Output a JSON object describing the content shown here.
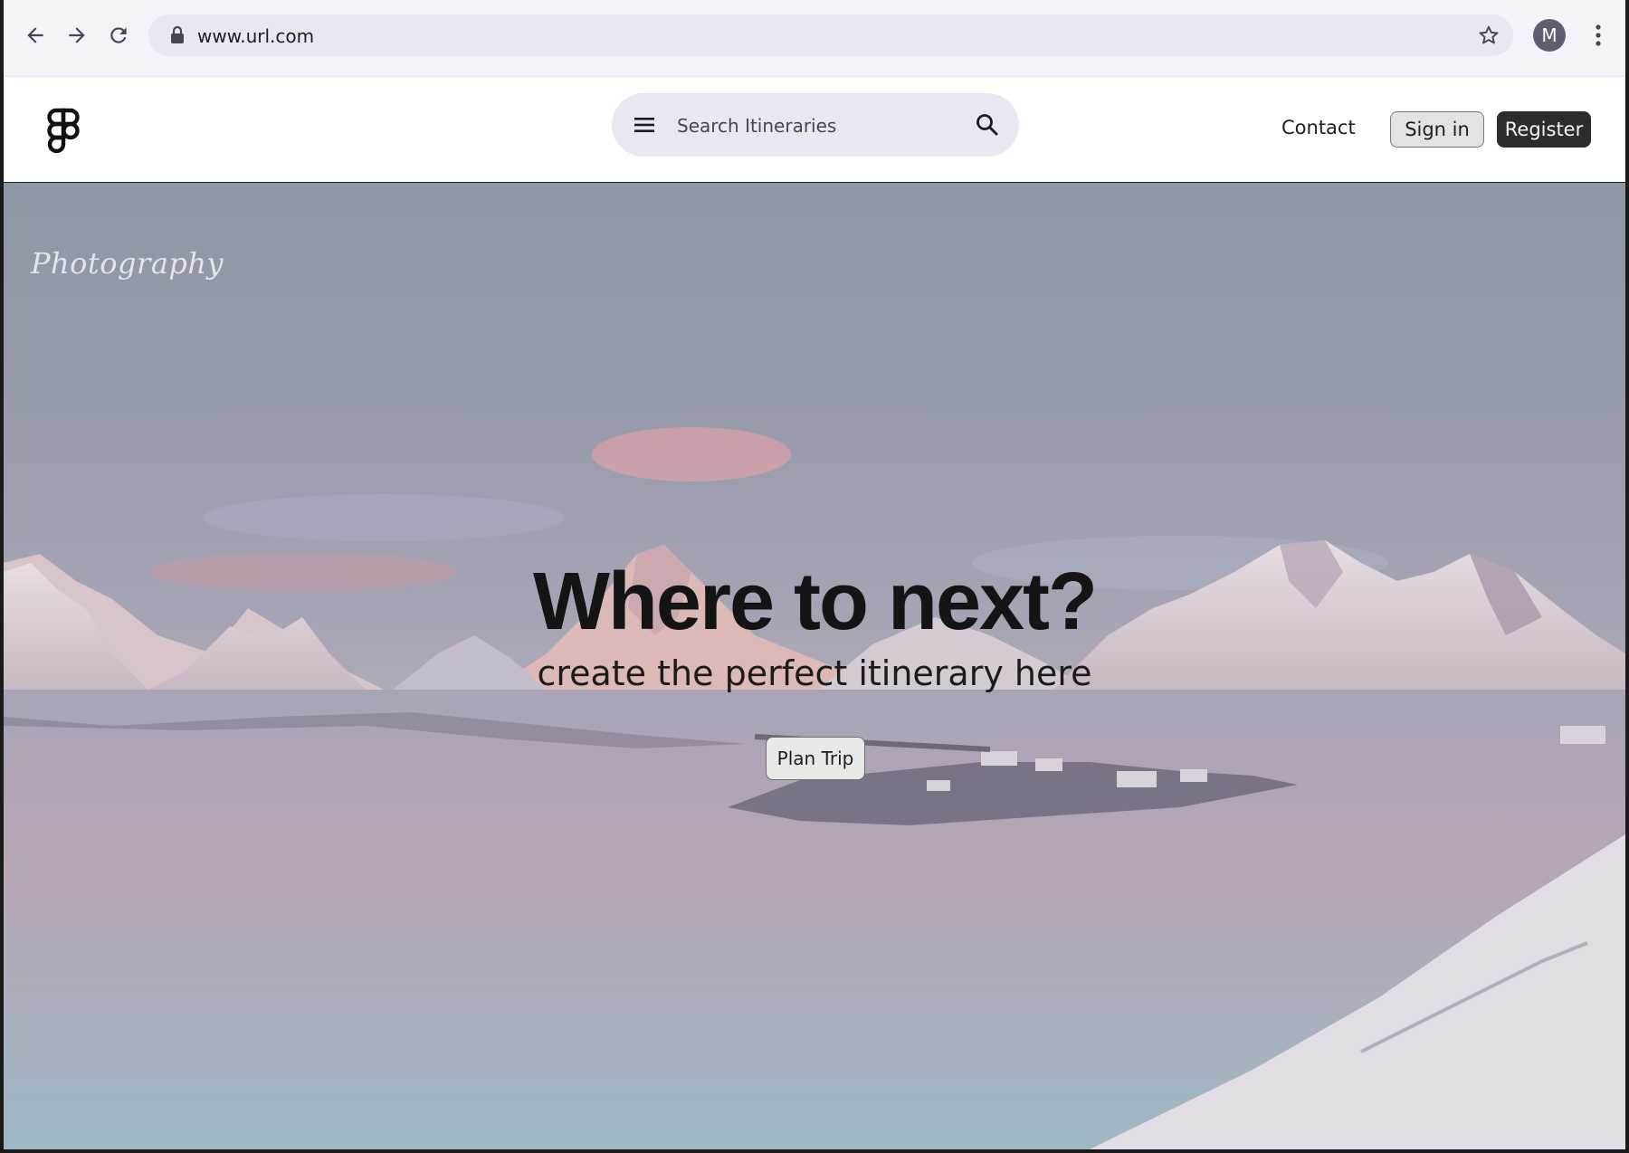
{
  "browser": {
    "url": "www.url.com",
    "profile_initial": "M",
    "icons": [
      "back-arrow-icon",
      "forward-arrow-icon",
      "reload-icon",
      "lock-icon",
      "bookmark-star-icon",
      "more-vert-icon"
    ]
  },
  "header": {
    "search_placeholder": "Search Itineraries",
    "nav": {
      "contact": "Contact",
      "sign_in": "Sign in",
      "register": "Register"
    }
  },
  "hero": {
    "watermark": "Photography",
    "title": "Where to next?",
    "subtitle": "create the perfect itinerary here",
    "cta": "Plan Trip"
  },
  "colors": {
    "chrome_bg": "#f7f2f9",
    "search_bg": "#ece6f0",
    "register_bg": "#2c2c2c",
    "sign_in_bg": "#e3e3e3",
    "avatar_bg": "#625b71"
  }
}
